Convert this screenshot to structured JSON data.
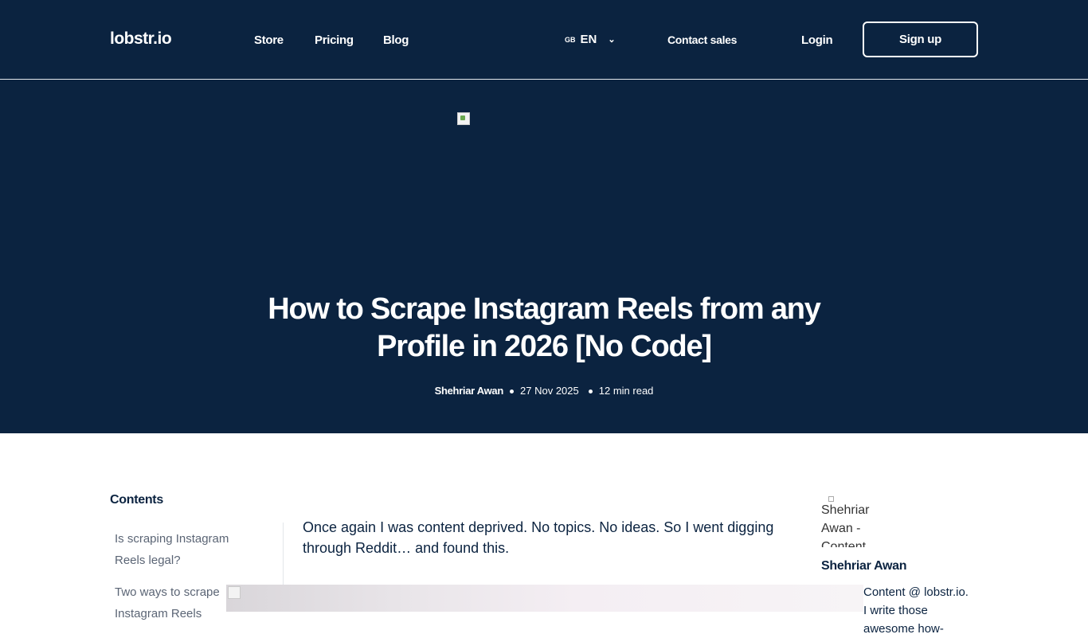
{
  "header": {
    "logo": "lobstr.io",
    "nav": [
      "Store",
      "Pricing",
      "Blog"
    ],
    "lang_flag": "GB",
    "lang": "EN",
    "contact": "Contact sales",
    "login": "Login",
    "signup": "Sign up"
  },
  "hero": {
    "title": "How to Scrape Instagram Reels from any Profile in 2026 [No Code]",
    "author": "Shehriar Awan",
    "date": "27 Nov 2025",
    "read_time": "12 min read"
  },
  "toc": {
    "title": "Contents",
    "items": [
      "Is scraping Instagram Reels legal?",
      "Two ways to scrape Instagram Reels"
    ]
  },
  "article": {
    "intro": "Once again I was content deprived. No topics. No ideas. So I went digging through Reddit… and found this."
  },
  "sidebar": {
    "avatar_alt": "Shehriar Awan - Content",
    "name": "Shehriar Awan",
    "bio": "Content @ lobstr.io. I write those awesome how-"
  }
}
